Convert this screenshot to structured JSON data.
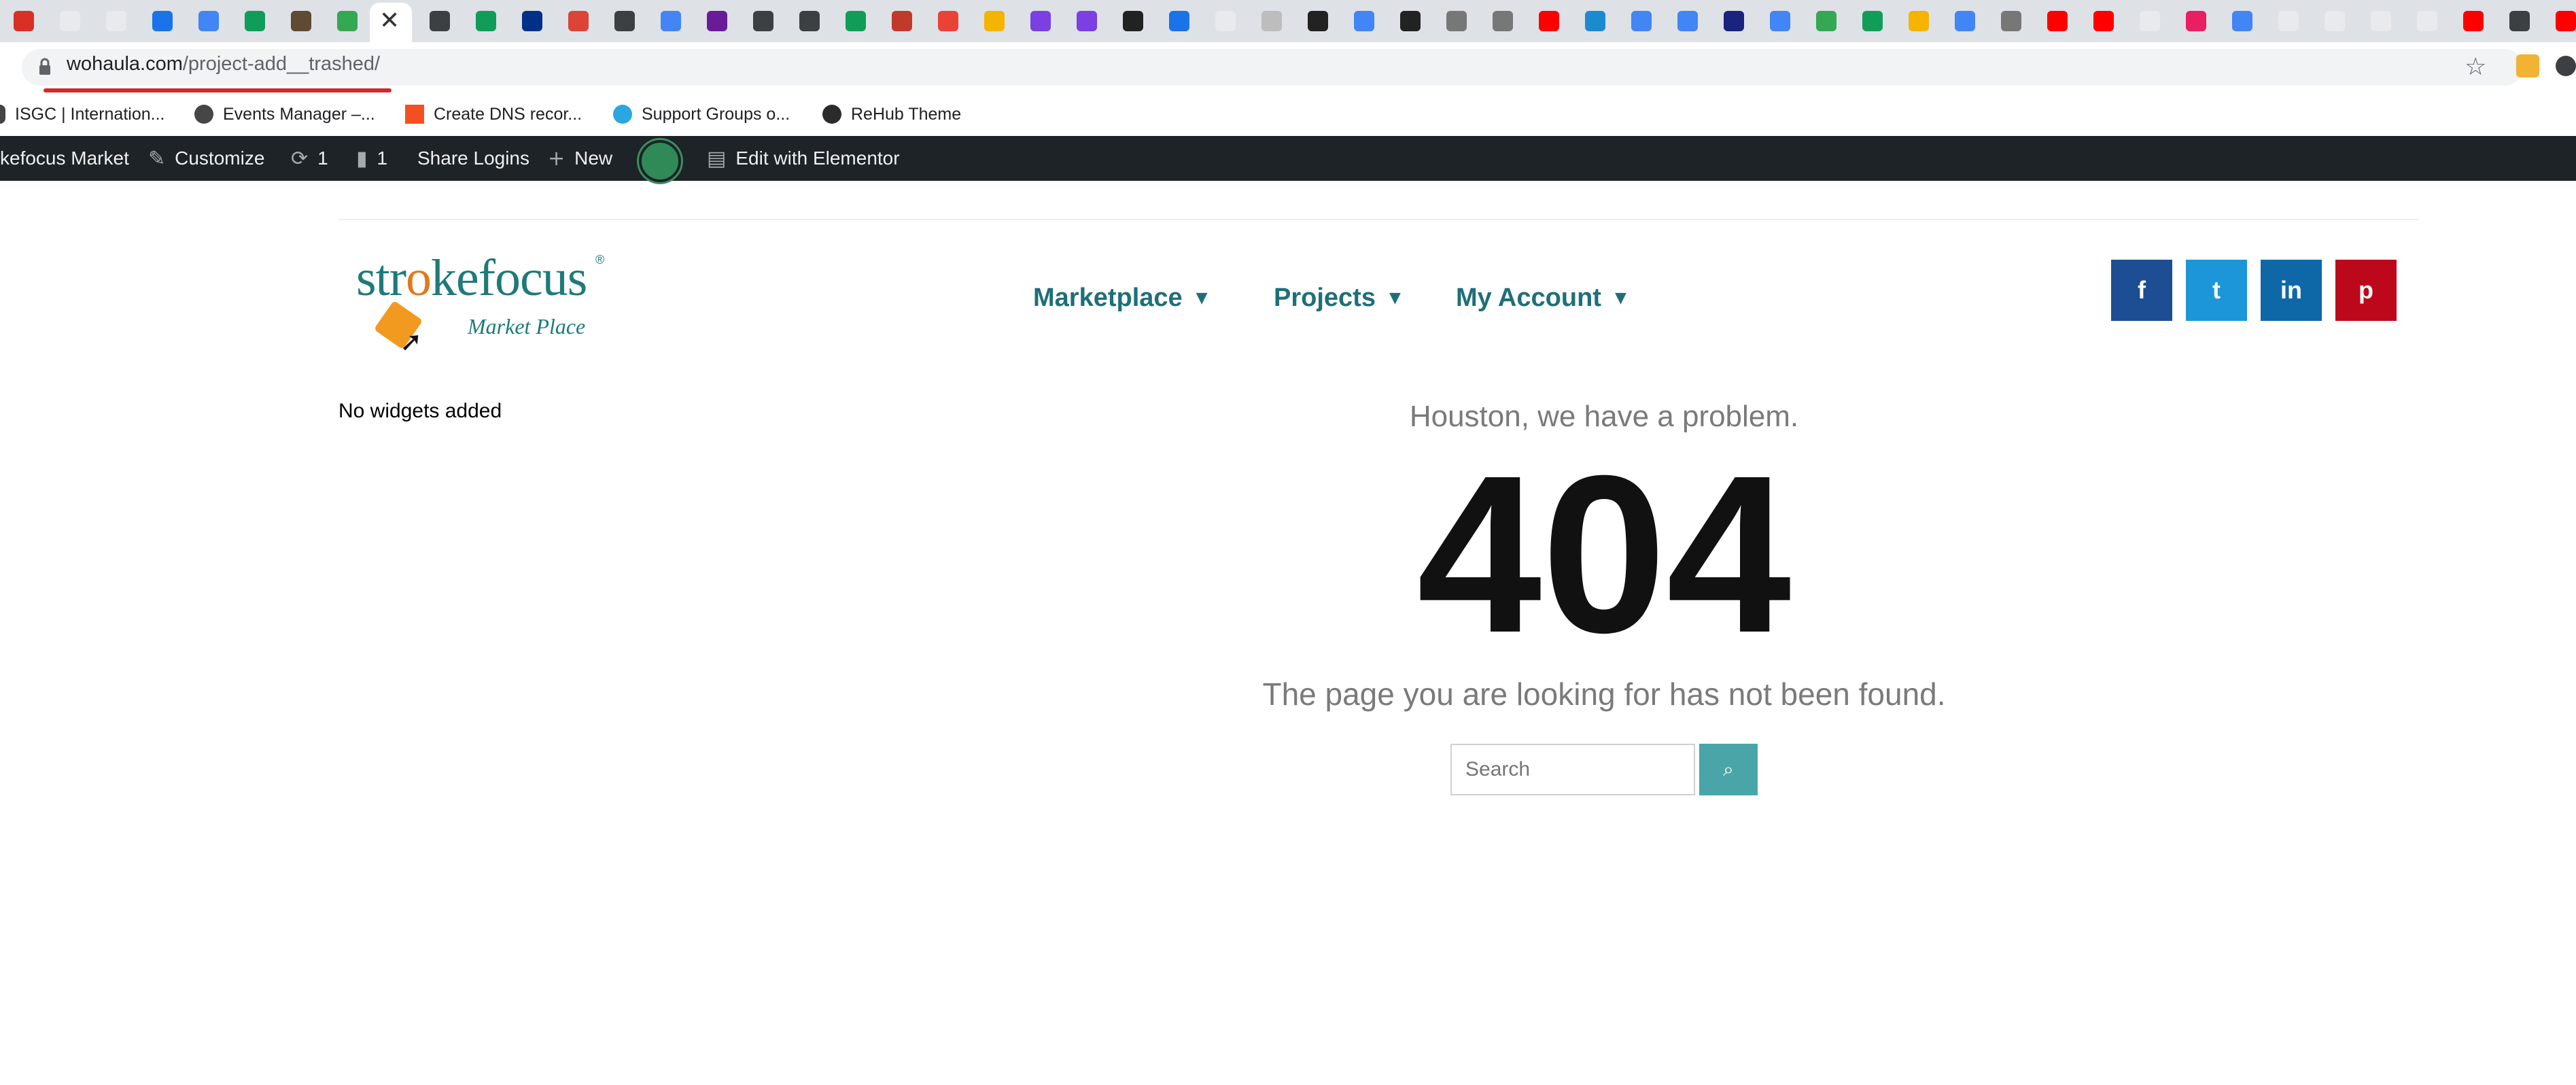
{
  "browser": {
    "url_host": "wohaula.com",
    "url_path": "/project-add__trashed/",
    "tab_close_glyph": "✕",
    "star_icon": "star-icon",
    "tab_colors": [
      "#d93025",
      "#e8eaed",
      "#e8eaed",
      "#1a73e8",
      "#4285f4",
      "#0f9d58",
      "#5f4b32",
      "#34a853",
      "#ffffff",
      "#3c4043",
      "#0f9d58",
      "#003087",
      "#db4437",
      "#3c4043",
      "#4285f4",
      "#6a1b9a",
      "#3c4043",
      "#3c4043",
      "#0f9d58",
      "#c0392b",
      "#ea4335",
      "#f4b400",
      "#7b3fe4",
      "#7b3fe4",
      "#222222",
      "#1a73e8",
      "#e8eaed",
      "#bdbdbd",
      "#222222",
      "#4285f4",
      "#222222",
      "#777777",
      "#777777",
      "#ff0000",
      "#1b8bd1",
      "#4285f4",
      "#4285f4",
      "#1a237e",
      "#4285f4",
      "#34a853",
      "#0f9d58",
      "#f4b400",
      "#4285f4",
      "#777777",
      "#ff0000",
      "#ff0000",
      "#e8eaed",
      "#e91e63",
      "#4285f4",
      "#e8eaed",
      "#e8eaed",
      "#e8eaed",
      "#e8eaed",
      "#ff0000",
      "#3c4043",
      "#ff0000"
    ]
  },
  "bookmarks": [
    {
      "label": "ISGC | Internation...",
      "color": "#444444"
    },
    {
      "label": "Events Manager –...",
      "color": "#464646"
    },
    {
      "label": "Create DNS recor...",
      "color": "#f25022"
    },
    {
      "label": "Support Groups o...",
      "color": "#2aa7e0"
    },
    {
      "label": "ReHub Theme",
      "color": "#2b2b2b"
    }
  ],
  "adminbar": {
    "site": "kefocus Market",
    "customize": "Customize",
    "updates": "1",
    "comments": "1",
    "share_logins": "Share Logins",
    "new": "New",
    "edit_elementor": "Edit with Elementor"
  },
  "header": {
    "logo_word_1": "str",
    "logo_word_o": "o",
    "logo_word_2": "kefocus",
    "logo_reg": "®",
    "logo_tagline": "Market Place",
    "nav": [
      {
        "label": "Marketplace"
      },
      {
        "label": "Projects"
      },
      {
        "label": "My Account"
      }
    ],
    "social": {
      "facebook": "f",
      "twitter": "t",
      "linkedin": "in",
      "pinterest": "p"
    }
  },
  "sidebar": {
    "text": "No widgets added"
  },
  "error": {
    "headline": "Houston, we have a problem.",
    "code": "404",
    "message": "The page you are looking for has not been found.",
    "search_placeholder": "Search"
  }
}
